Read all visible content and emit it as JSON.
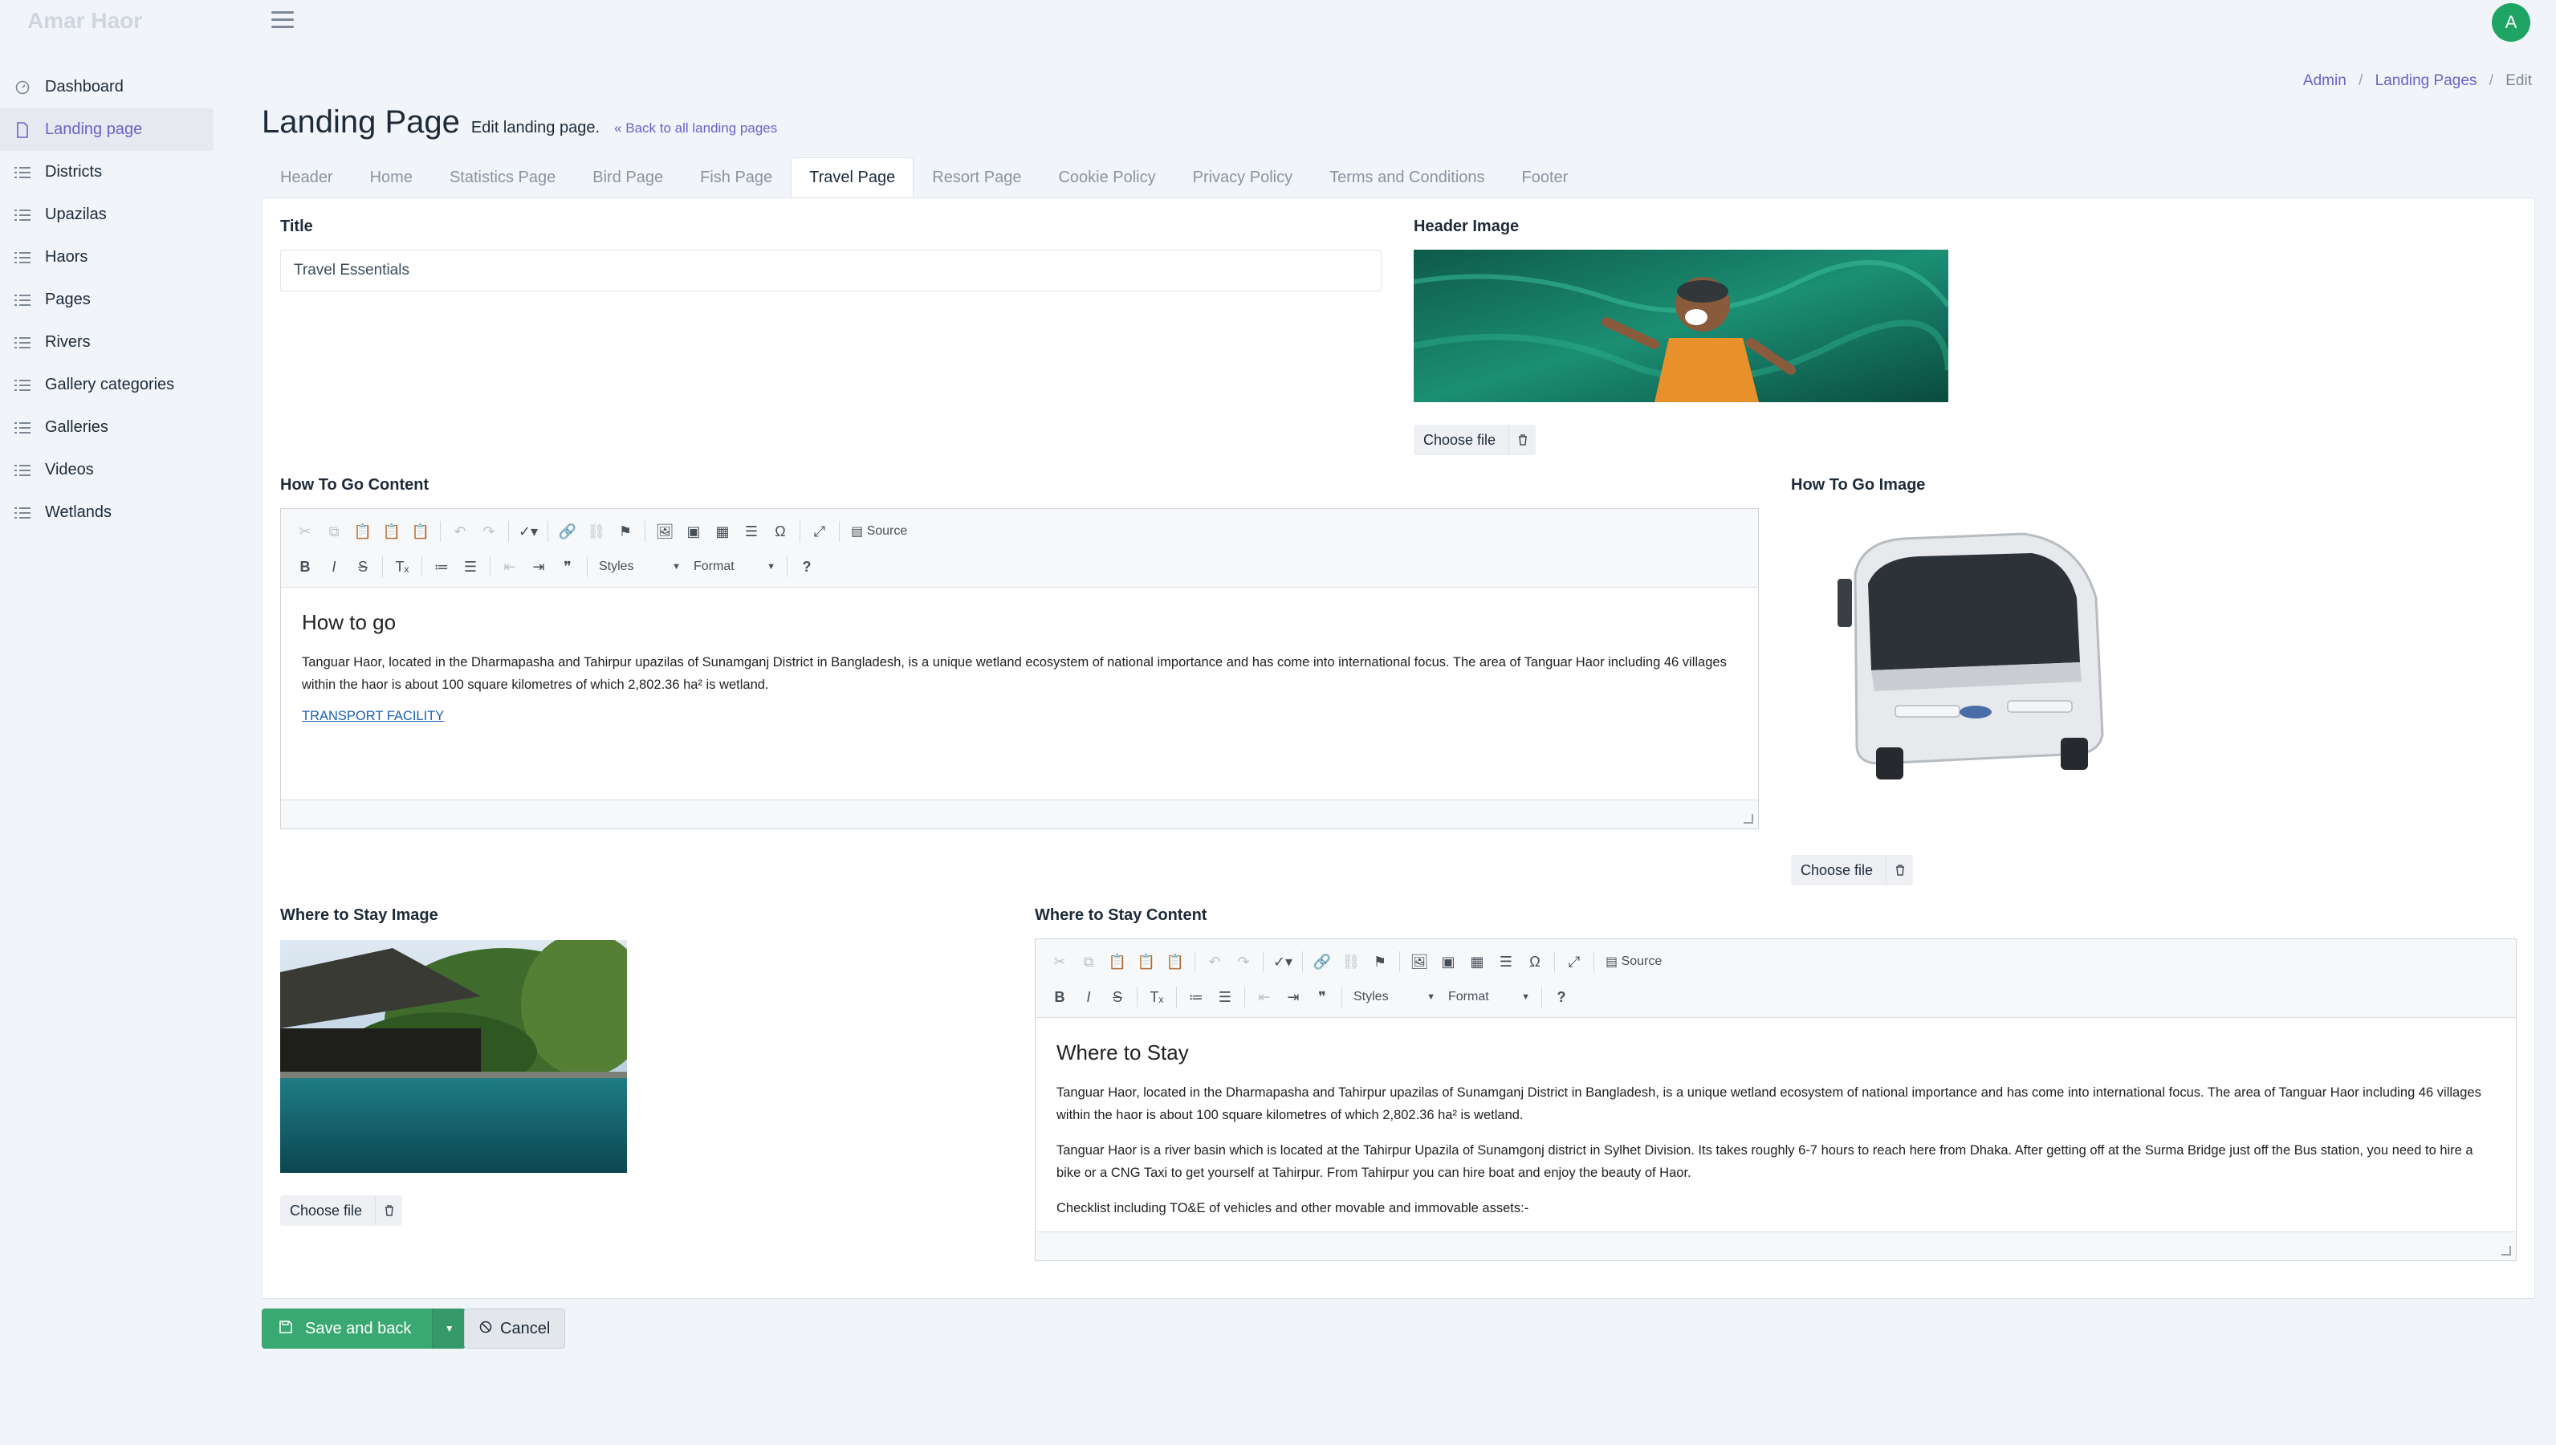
{
  "app": {
    "brand": "Amar Haor",
    "avatar_letter": "A"
  },
  "sidebar": {
    "items": [
      {
        "label": "Dashboard",
        "icon": "gauge-icon"
      },
      {
        "label": "Landing page",
        "icon": "file-icon",
        "active": true
      },
      {
        "label": "Districts",
        "icon": "list-icon"
      },
      {
        "label": "Upazilas",
        "icon": "list-icon"
      },
      {
        "label": "Haors",
        "icon": "list-icon"
      },
      {
        "label": "Pages",
        "icon": "list-icon"
      },
      {
        "label": "Rivers",
        "icon": "list-icon"
      },
      {
        "label": "Gallery categories",
        "icon": "list-icon"
      },
      {
        "label": "Galleries",
        "icon": "list-icon"
      },
      {
        "label": "Videos",
        "icon": "list-icon"
      },
      {
        "label": "Wetlands",
        "icon": "list-icon"
      }
    ]
  },
  "breadcrumb": {
    "admin": "Admin",
    "landing_pages": "Landing Pages",
    "edit": "Edit",
    "sep": "/"
  },
  "header": {
    "title": "Landing Page",
    "subtitle": "Edit landing page.",
    "back_link": "Back to all landing pages"
  },
  "tabs": [
    "Header",
    "Home",
    "Statistics Page",
    "Bird Page",
    "Fish Page",
    "Travel Page",
    "Resort Page",
    "Cookie Policy",
    "Privacy Policy",
    "Terms and Conditions",
    "Footer"
  ],
  "active_tab": "Travel Page",
  "form": {
    "title_label": "Title",
    "title_value": "Travel Essentials",
    "header_image_label": "Header Image",
    "how_to_go_label": "How To Go Content",
    "how_to_go_image_label": "How To Go Image",
    "where_to_stay_image_label": "Where to Stay Image",
    "where_to_stay_content_label": "Where to Stay Content",
    "choose_file": "Choose file"
  },
  "editor": {
    "source_label": "Source",
    "styles_label": "Styles",
    "format_label": "Format",
    "help_label": "?"
  },
  "how_to_go": {
    "heading": "How to go",
    "paragraph": "Tanguar Haor, located in the Dharmapasha and Tahirpur upazilas of Sunamganj District in Bangladesh, is a unique wetland ecosystem of national importance and has come into international focus. The area of Tanguar Haor including 46 villages within the haor is about 100 square kilometres of which 2,802.36 ha² is wetland.",
    "link": "TRANSPORT FACILITY"
  },
  "where_to_stay": {
    "heading": "Where to Stay",
    "paragraph1": "Tanguar Haor, located in the Dharmapasha and Tahirpur upazilas of Sunamganj District in Bangladesh, is a unique wetland ecosystem of national importance and has come into international focus. The area of Tanguar Haor including 46 villages within the haor is about 100 square kilometres of which 2,802.36 ha² is wetland.",
    "paragraph2": "Tanguar Haor is a river basin which is located at the Tahirpur Upazila of Sunamgonj district in Sylhet Division. Its takes roughly 6-7 hours to reach here from Dhaka. After getting off at the Surma Bridge just off the Bus station, you need to hire a bike or a CNG Taxi to get yourself at Tahirpur. From Tahirpur you can hire boat and enjoy the beauty of Haor.",
    "paragraph3": "Checklist including TO&E of vehicles and other movable and immovable assets:-"
  },
  "buttons": {
    "save": "Save and back",
    "cancel": "Cancel"
  },
  "colors": {
    "accent": "#6b62c9",
    "save_green": "#3aa873",
    "avatar_green": "#1fa463"
  }
}
